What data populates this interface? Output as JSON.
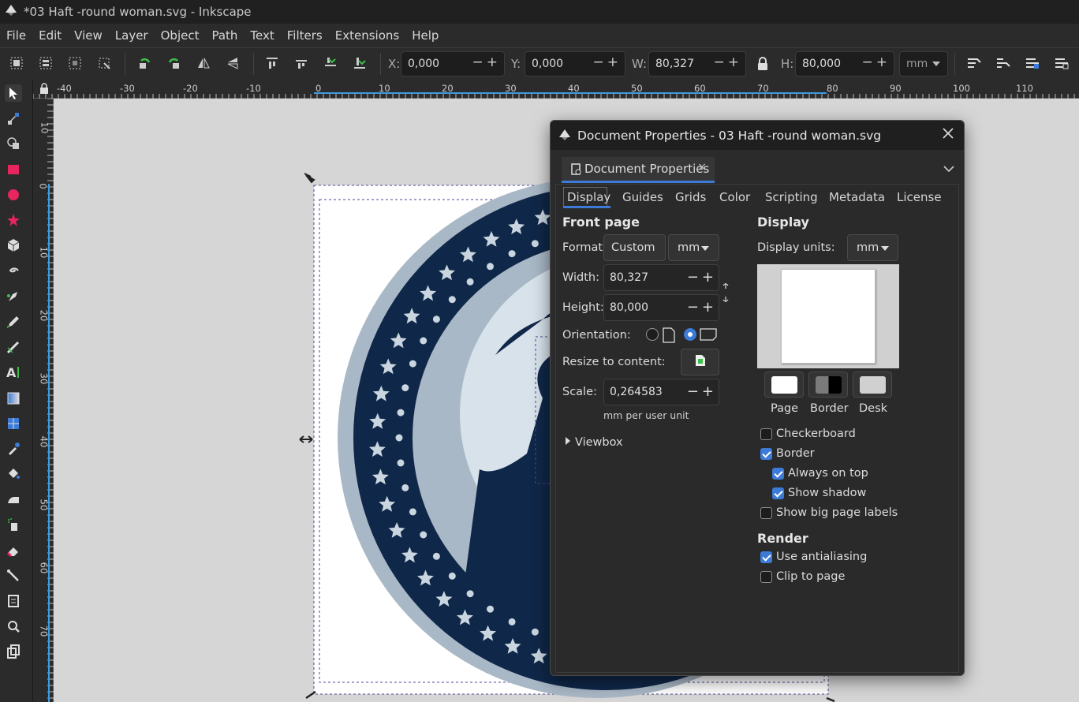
{
  "window": {
    "title": "*03 Haft -round woman.svg - Inkscape"
  },
  "menu": [
    "File",
    "Edit",
    "View",
    "Layer",
    "Object",
    "Path",
    "Text",
    "Filters",
    "Extensions",
    "Help"
  ],
  "toolbar": {
    "x_label": "X:",
    "x_value": "0,000",
    "y_label": "Y:",
    "y_value": "0,000",
    "w_label": "W:",
    "w_value": "80,327",
    "h_label": "H:",
    "h_value": "80,000",
    "unit": "mm",
    "pm": "−+"
  },
  "ruler": {
    "h_labels": [
      "-40",
      "-30",
      "-20",
      "-10",
      "0",
      "10",
      "20",
      "30",
      "40",
      "50",
      "60",
      "70",
      "80",
      "90",
      "100",
      "110"
    ],
    "v_labels": [
      "10",
      "0",
      "10",
      "20",
      "30",
      "40",
      "50",
      "60",
      "70"
    ]
  },
  "dialog": {
    "title": "Document Properties - 03 Haft -round woman.svg",
    "tab_title": "Document Properties",
    "tab_close": "×",
    "tabs": [
      "Display",
      "Guides",
      "Grids",
      "Color",
      "Scripting",
      "Metadata",
      "License"
    ],
    "front_page": {
      "heading": "Front page",
      "format_label": "Format:",
      "format_value": "Custom",
      "format_unit": "mm",
      "width_label": "Width:",
      "width_value": "80,327",
      "height_label": "Height:",
      "height_value": "80,000",
      "orientation_label": "Orientation:",
      "resize_label": "Resize to content:",
      "scale_label": "Scale:",
      "scale_value": "0,264583",
      "scale_unit_note": "mm per user unit",
      "viewbox_label": "Viewbox"
    },
    "display": {
      "heading": "Display",
      "units_label": "Display units:",
      "units_value": "mm",
      "swatches": [
        "Page",
        "Border",
        "Desk"
      ],
      "checks": [
        {
          "label": "Checkerboard",
          "checked": false
        },
        {
          "label": "Border",
          "checked": true
        },
        {
          "label": "Always on top",
          "checked": true
        },
        {
          "label": "Show shadow",
          "checked": true
        },
        {
          "label": "Show big page labels",
          "checked": false
        }
      ]
    },
    "render": {
      "heading": "Render",
      "checks": [
        {
          "label": "Use antialiasing",
          "checked": true
        },
        {
          "label": "Clip to page",
          "checked": false
        }
      ]
    }
  },
  "colors": {
    "navy": "#0f2748",
    "accent": "#3d7bd8",
    "dark": "#2b2b2b"
  }
}
